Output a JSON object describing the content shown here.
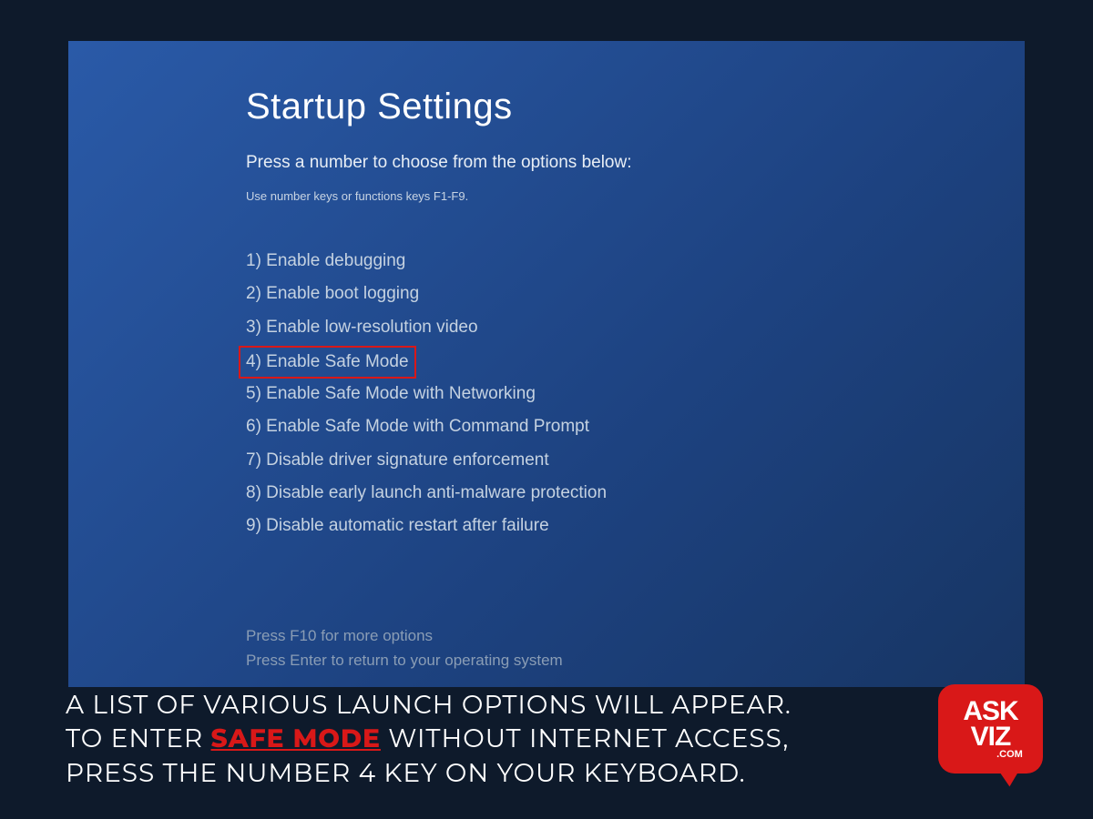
{
  "screen": {
    "title": "Startup Settings",
    "subtitle": "Press a number to choose from the options below:",
    "hint": "Use number keys or functions keys F1-F9.",
    "options": [
      {
        "label": "1) Enable debugging",
        "highlighted": false
      },
      {
        "label": "2) Enable boot logging",
        "highlighted": false
      },
      {
        "label": "3) Enable low-resolution video",
        "highlighted": false
      },
      {
        "label": "4) Enable Safe Mode",
        "highlighted": true
      },
      {
        "label": "5) Enable Safe Mode with Networking",
        "highlighted": false
      },
      {
        "label": "6) Enable Safe Mode with Command Prompt",
        "highlighted": false
      },
      {
        "label": "7) Disable driver signature enforcement",
        "highlighted": false
      },
      {
        "label": "8) Disable early launch anti-malware protection",
        "highlighted": false
      },
      {
        "label": "9) Disable automatic restart after failure",
        "highlighted": false
      }
    ],
    "footer_hints": [
      "Press F10 for more options",
      "Press Enter to return to your operating system"
    ]
  },
  "caption": {
    "part1": "A LIST OF VARIOUS LAUNCH OPTIONS WILL APPEAR. TO ENTER ",
    "emphasis": "SAFE MODE",
    "part2": " WITHOUT INTERNET ACCESS, PRESS THE NUMBER 4 KEY ON YOUR KEYBOARD."
  },
  "logo": {
    "line1": "ASK",
    "line2": "VIZ",
    "sub": ".COM"
  }
}
